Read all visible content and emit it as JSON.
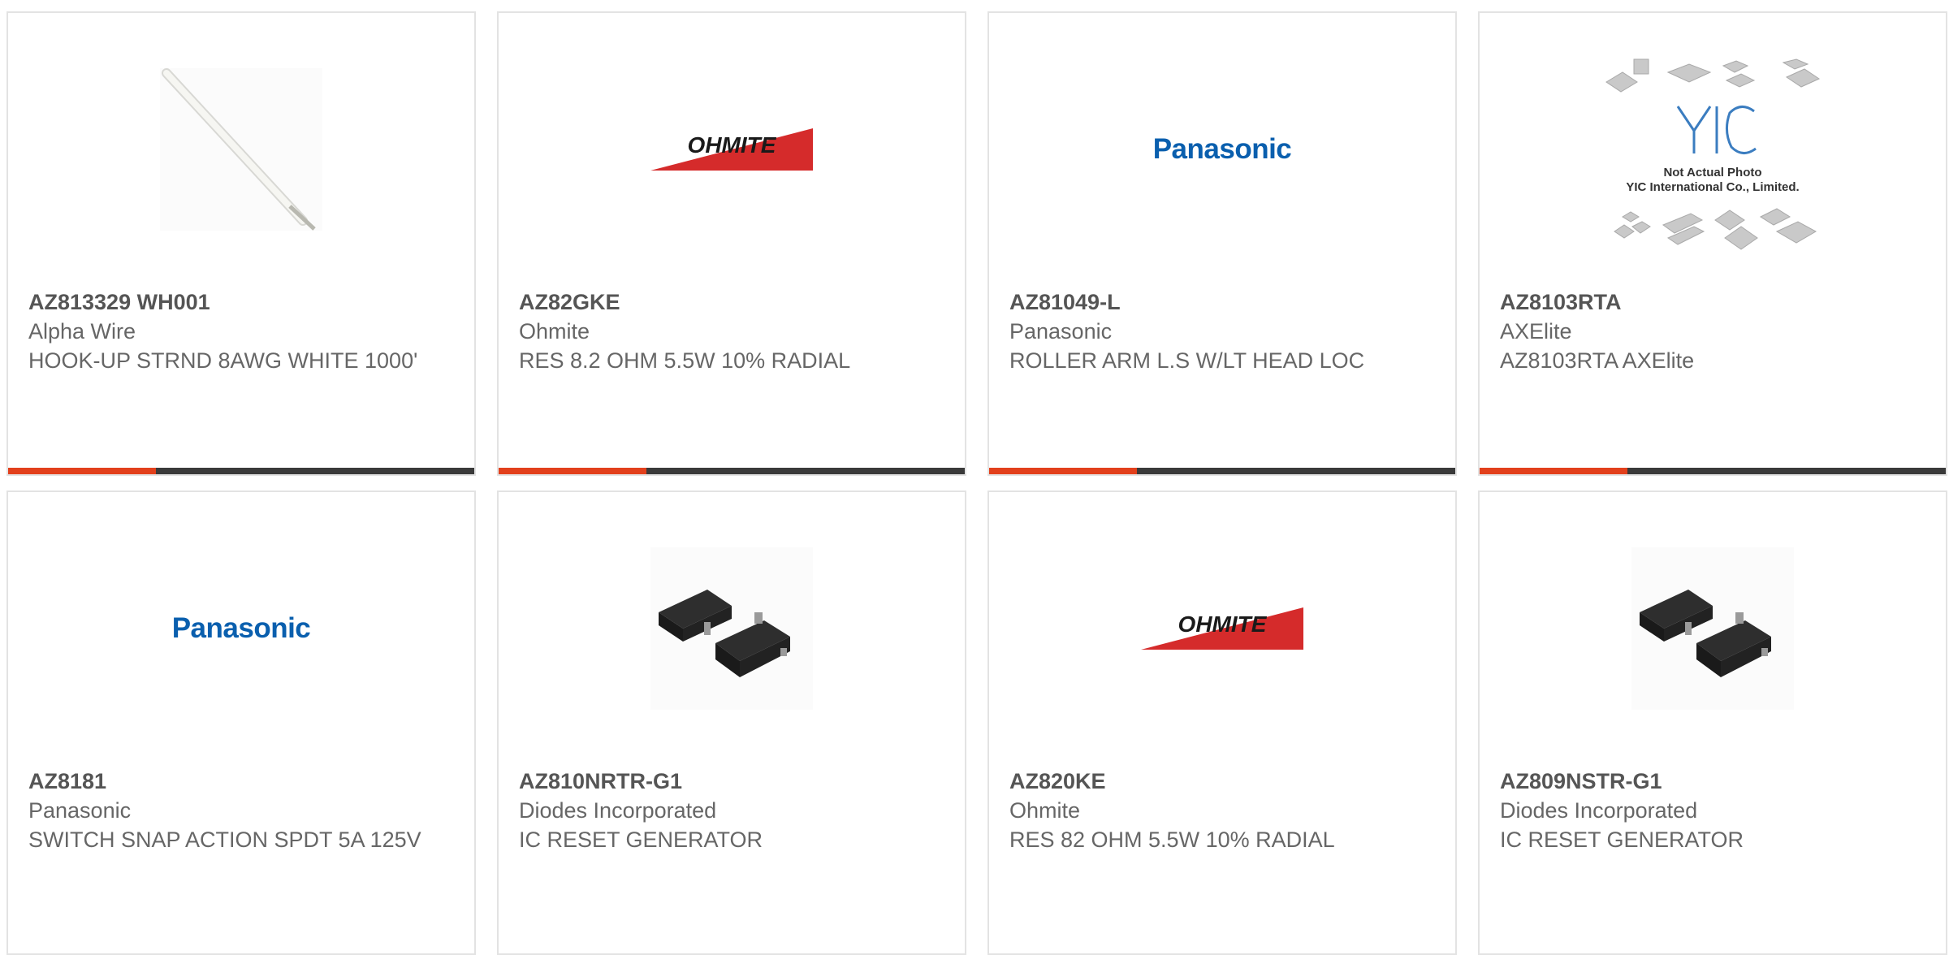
{
  "colors": {
    "accent": "#e2401c",
    "bar": "#3a3a3a",
    "panasonic_blue": "#0a5fae",
    "ohmite_red": "#d52b2b"
  },
  "products": [
    {
      "part": "AZ813329 WH001",
      "mfr": "Alpha Wire",
      "desc": "HOOK-UP STRND 8AWG WHITE 1000'",
      "image": "white-wire-image"
    },
    {
      "part": "AZ82GKE",
      "mfr": "Ohmite",
      "desc": "RES 8.2 OHM 5.5W 10% RADIAL",
      "image": "ohmite-logo",
      "logo_text": "OHMITE"
    },
    {
      "part": "AZ81049-L",
      "mfr": "Panasonic",
      "desc": "ROLLER ARM L.S W/LT HEAD LOC",
      "image": "panasonic-logo",
      "logo_text": "Panasonic"
    },
    {
      "part": "AZ8103RTA",
      "mfr": "AXElite",
      "desc": "AZ8103RTA AXElite",
      "image": "not-actual-photo-placeholder",
      "placeholder_lines": [
        "Not Actual Photo",
        "YIC International Co., Limited."
      ],
      "placeholder_logo": "YIC"
    },
    {
      "part": "AZ8181",
      "mfr": "Panasonic",
      "desc": "SWITCH SNAP ACTION SPDT 5A 125V",
      "image": "panasonic-logo",
      "logo_text": "Panasonic"
    },
    {
      "part": "AZ810NRTR-G1",
      "mfr": "Diodes Incorporated",
      "desc": "IC RESET GENERATOR",
      "image": "sot23-chip-image"
    },
    {
      "part": "AZ820KE",
      "mfr": "Ohmite",
      "desc": "RES 82 OHM 5.5W 10% RADIAL",
      "image": "ohmite-logo",
      "logo_text": "OHMITE"
    },
    {
      "part": "AZ809NSTR-G1",
      "mfr": "Diodes Incorporated",
      "desc": "IC RESET GENERATOR",
      "image": "sot23-chip-image"
    }
  ]
}
